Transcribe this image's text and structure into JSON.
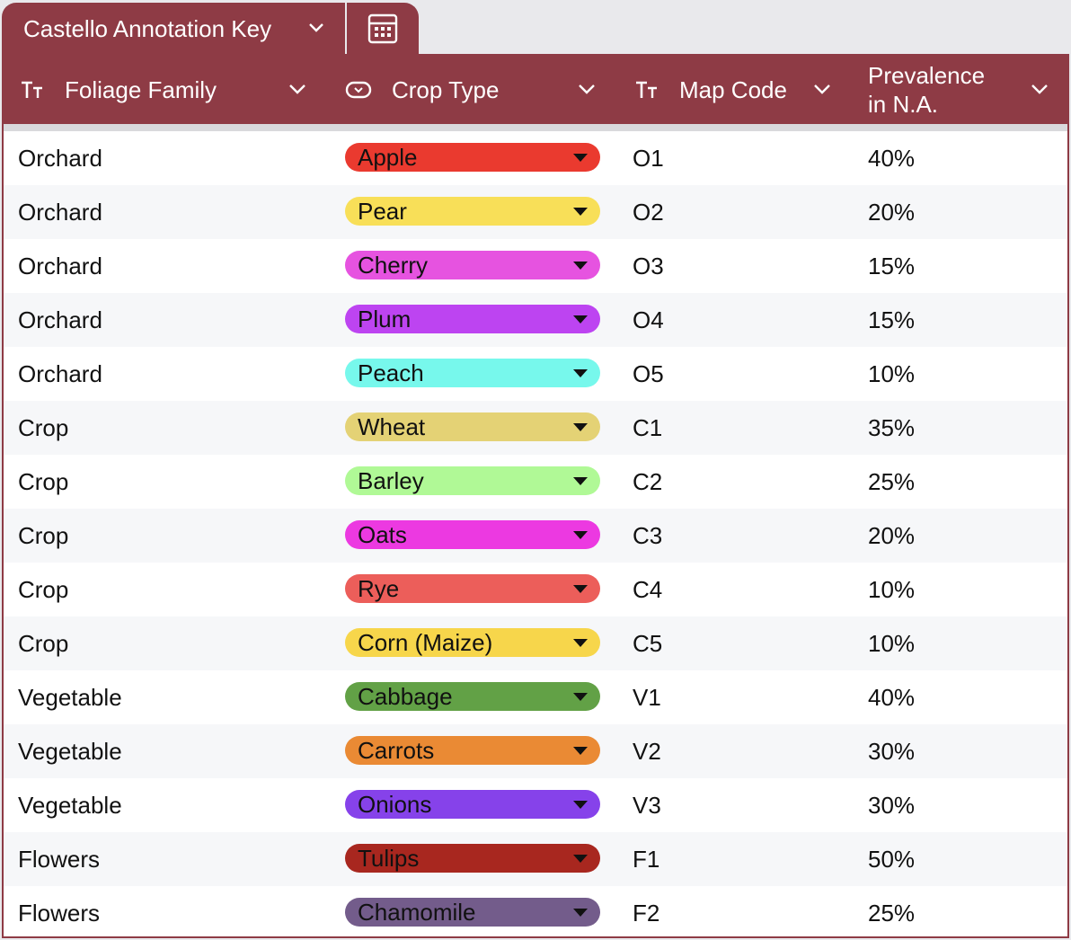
{
  "tab": {
    "title": "Castello Annotation Key",
    "icon": "calculator-icon"
  },
  "columns": {
    "family": {
      "label": "Foliage Family",
      "icon": "text-type-icon"
    },
    "crop": {
      "label": "Crop Type",
      "icon": "single-select-icon"
    },
    "code": {
      "label": "Map Code",
      "icon": "text-type-icon"
    },
    "prev": {
      "label_line1": "Prevalence",
      "label_line2": "in N.A."
    }
  },
  "rows": [
    {
      "family": "Orchard",
      "crop": "Apple",
      "color": "#ea3a2f",
      "code": "O1",
      "prev": "40%"
    },
    {
      "family": "Orchard",
      "crop": "Pear",
      "color": "#f8df58",
      "code": "O2",
      "prev": "20%"
    },
    {
      "family": "Orchard",
      "crop": "Cherry",
      "color": "#e653e0",
      "code": "O3",
      "prev": "15%"
    },
    {
      "family": "Orchard",
      "crop": "Plum",
      "color": "#bd44f1",
      "code": "O4",
      "prev": "15%"
    },
    {
      "family": "Orchard",
      "crop": "Peach",
      "color": "#77f8ec",
      "code": "O5",
      "prev": "10%"
    },
    {
      "family": "Crop",
      "crop": "Wheat",
      "color": "#e4d275",
      "code": "C1",
      "prev": "35%"
    },
    {
      "family": "Crop",
      "crop": "Barley",
      "color": "#b0f996",
      "code": "C2",
      "prev": "25%"
    },
    {
      "family": "Crop",
      "crop": "Oats",
      "color": "#ec39e1",
      "code": "C3",
      "prev": "20%"
    },
    {
      "family": "Crop",
      "crop": "Rye",
      "color": "#ec5e5a",
      "code": "C4",
      "prev": "10%"
    },
    {
      "family": "Crop",
      "crop": "Corn (Maize)",
      "color": "#f7d64b",
      "code": "C5",
      "prev": "10%"
    },
    {
      "family": "Vegetable",
      "crop": "Cabbage",
      "color": "#62a146",
      "code": "V1",
      "prev": "40%"
    },
    {
      "family": "Vegetable",
      "crop": "Carrots",
      "color": "#ea8a34",
      "code": "V2",
      "prev": "30%"
    },
    {
      "family": "Vegetable",
      "crop": "Onions",
      "color": "#8642ea",
      "code": "V3",
      "prev": "30%"
    },
    {
      "family": "Flowers",
      "crop": "Tulips",
      "color": "#a8271f",
      "code": "F1",
      "prev": "50%"
    },
    {
      "family": "Flowers",
      "crop": "Chamomile",
      "color": "#735c8b",
      "code": "F2",
      "prev": "25%"
    }
  ]
}
